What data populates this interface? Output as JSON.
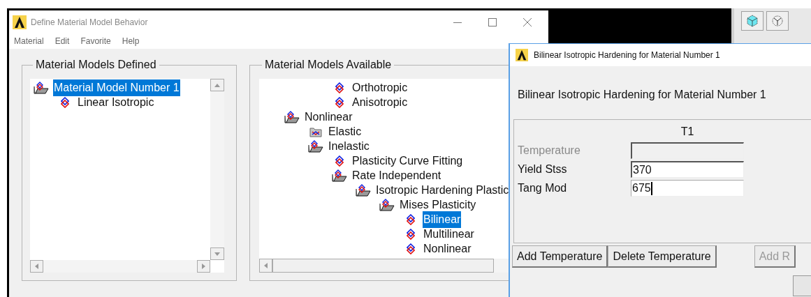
{
  "main_window": {
    "title": "Define Material Model Behavior",
    "menu": [
      "Material",
      "Edit",
      "Favorite",
      "Help"
    ],
    "defined": {
      "title": "Material Models Defined",
      "items": [
        {
          "label": "Material Model Number 1",
          "kind": "folder_open",
          "selected": true,
          "children": [
            {
              "label": "Linear Isotropic",
              "kind": "leaf",
              "selected": false
            }
          ]
        }
      ]
    },
    "available": {
      "title": "Material Models Available",
      "items": [
        {
          "label": "Orthotropic",
          "kind": "leaf",
          "selected": false
        },
        {
          "label": "Anisotropic",
          "kind": "leaf",
          "selected": false
        },
        {
          "label": "Nonlinear",
          "kind": "folder_open",
          "selected": false,
          "children": [
            {
              "label": "Elastic",
              "kind": "folder_closed",
              "selected": false
            },
            {
              "label": "Inelastic",
              "kind": "folder_open",
              "selected": false,
              "children": [
                {
                  "label": "Plasticity Curve Fitting",
                  "kind": "leaf",
                  "selected": false
                },
                {
                  "label": "Rate Independent",
                  "kind": "folder_open",
                  "selected": false,
                  "children": [
                    {
                      "label": "Isotropic Hardening Plastic",
                      "kind": "folder_open",
                      "selected": false,
                      "children": [
                        {
                          "label": "Mises Plasticity",
                          "kind": "folder_open",
                          "selected": false,
                          "children": [
                            {
                              "label": "Bilinear",
                              "kind": "leaf",
                              "selected": true
                            },
                            {
                              "label": "Multilinear",
                              "kind": "leaf",
                              "selected": false
                            },
                            {
                              "label": "Nonlinear",
                              "kind": "leaf",
                              "selected": false
                            }
                          ]
                        }
                      ]
                    }
                  ]
                }
              ]
            }
          ]
        }
      ]
    }
  },
  "dialog": {
    "title": "Bilinear Isotropic Hardening for Material Number 1",
    "heading": "Bilinear Isotropic Hardening for Material Number 1",
    "column": "T1",
    "rows": [
      {
        "label": "Temperature",
        "disabled": true,
        "focused": false
      },
      {
        "label": "Yield Stss",
        "value": "370",
        "disabled": false,
        "focused": false
      },
      {
        "label": "Tang Mod",
        "value": "675",
        "disabled": false,
        "focused": true
      }
    ],
    "buttons": [
      {
        "label": "Add Temperature",
        "disabled": false
      },
      {
        "label": "Delete Temperature",
        "disabled": false
      },
      {
        "label": "Add R",
        "disabled": true
      }
    ]
  }
}
